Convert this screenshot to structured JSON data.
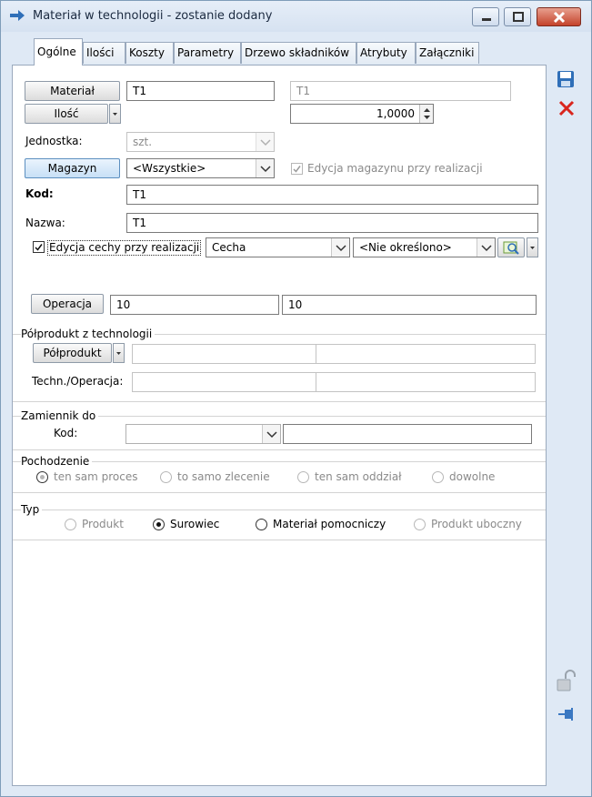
{
  "window": {
    "title": "Materiał w technologii - zostanie dodany"
  },
  "tabs": [
    "Ogólne",
    "Ilości",
    "Koszty",
    "Parametry",
    "Drzewo składników",
    "Atrybuty",
    "Załączniki"
  ],
  "form": {
    "material_button": "Materiał",
    "material_code": "T1",
    "material_name": "T1",
    "ilosc_button": "Ilość",
    "quantity": "1,0000",
    "jednostka_label": "Jednostka:",
    "jednostka_value": "szt.",
    "magazyn_button": "Magazyn",
    "magazyn_value": "<Wszystkie>",
    "edycja_magazynu_label": "Edycja magazynu przy realizacji",
    "kod_label": "Kod:",
    "kod_value": "T1",
    "nazwa_label": "Nazwa:",
    "nazwa_value": "T1",
    "edycja_cechy_label": "Edycja cechy przy realizacji",
    "cecha_value": "Cecha",
    "cecha_option": "<Nie określono>",
    "operacja_button": "Operacja",
    "operacja_value_1": "10",
    "operacja_value_2": "10"
  },
  "polprodukt": {
    "group_title": "Półprodukt z technologii",
    "button": "Półprodukt",
    "techn_label": "Techn./Operacja:"
  },
  "zamiennik": {
    "group_title": "Zamiennik do",
    "kod_label": "Kod:"
  },
  "pochodzenie": {
    "group_title": "Pochodzenie",
    "options": [
      "ten sam proces",
      "to samo zlecenie",
      "ten sam oddział",
      "dowolne"
    ],
    "selected": "ten sam proces"
  },
  "typ": {
    "group_title": "Typ",
    "options": [
      "Produkt",
      "Surowiec",
      "Materiał pomocniczy",
      "Produkt uboczny"
    ],
    "selected": "Surowiec"
  },
  "icons": {
    "save": "save-icon",
    "cancel": "cancel-icon",
    "lock": "unlock-icon",
    "pin": "pin-icon"
  },
  "colors": {
    "accent_blue": "#2f6fb8",
    "cancel_red": "#d9251d",
    "window_bg": "#dfe9f5"
  }
}
